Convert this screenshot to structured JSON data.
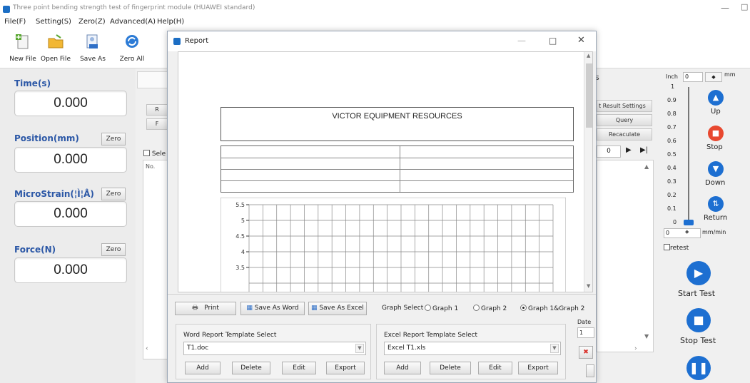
{
  "window": {
    "title": "Three point bending strength test of fingerprint module (HUAWEI standard)",
    "minimize": "—",
    "maximize": "□"
  },
  "menu": [
    "File(F)",
    "Setting(S)",
    "Zero(Z)",
    "Advanced(A)",
    "Help(H)"
  ],
  "toolbar": {
    "new_file": "New File",
    "open_file": "Open File",
    "save_as": "Save As",
    "zero_all": "Zero All"
  },
  "left_panel": {
    "time_label": "Time(s)",
    "time_value": "0.000",
    "position_label": "Position(mm)",
    "position_value": "0.000",
    "microstrain_label": "MicroStrain(¦Ì¦Å)",
    "microstrain_value": "0.000",
    "force_label": "Force(N)",
    "force_value": "0.000",
    "zero_label": "Zero"
  },
  "mid_panel": {
    "select_label": "Sele",
    "no_header": "No.",
    "result_settings": "t Result Settings",
    "query": "Query",
    "recalculate": "Recaculate",
    "page_value": "0",
    "s_fragment": "s",
    "r_fragment": "F",
    "r2_fragment": "R",
    "a_fragment": "A"
  },
  "report": {
    "title": "Report",
    "company": "VICTOR EQUIPMENT RESOURCES",
    "y_ticks": [
      "5.5",
      "5",
      "4.5",
      "4",
      "3.5"
    ],
    "print": "Print",
    "save_word": "Save As Word",
    "save_excel": "Save As Excel",
    "graph_select": "Graph Select",
    "graph1": "Graph 1",
    "graph2": "Graph 2",
    "graph12": "Graph 1&Graph 2",
    "graph_selected": "Graph 1&Graph 2",
    "word_group": "Word Report Template Select",
    "word_file": "T1.doc",
    "excel_group": "Excel Report Template Select",
    "excel_file": "Excel T1.xls",
    "add": "Add",
    "delete": "Delete",
    "edit": "Edit",
    "export": "Export",
    "date_label": "Date",
    "date_value": "1"
  },
  "right_panel": {
    "inch_label": "Inch",
    "inch_value": "0",
    "mm_label": "mm",
    "scale": [
      "1",
      "0.9",
      "0.8",
      "0.7",
      "0.6",
      "0.5",
      "0.4",
      "0.3",
      "0.2",
      "0.1",
      "0"
    ],
    "up": "Up",
    "stop": "Stop",
    "down": "Down",
    "return": "Return",
    "speed_value": "0",
    "speed_unit": "mm/min",
    "retest": "retest",
    "start_test": "Start Test",
    "stop_test": "Stop Test"
  },
  "colors": {
    "accent": "#1d6fd1",
    "label_blue": "#2b57a6",
    "stop_red": "#e8482f"
  }
}
